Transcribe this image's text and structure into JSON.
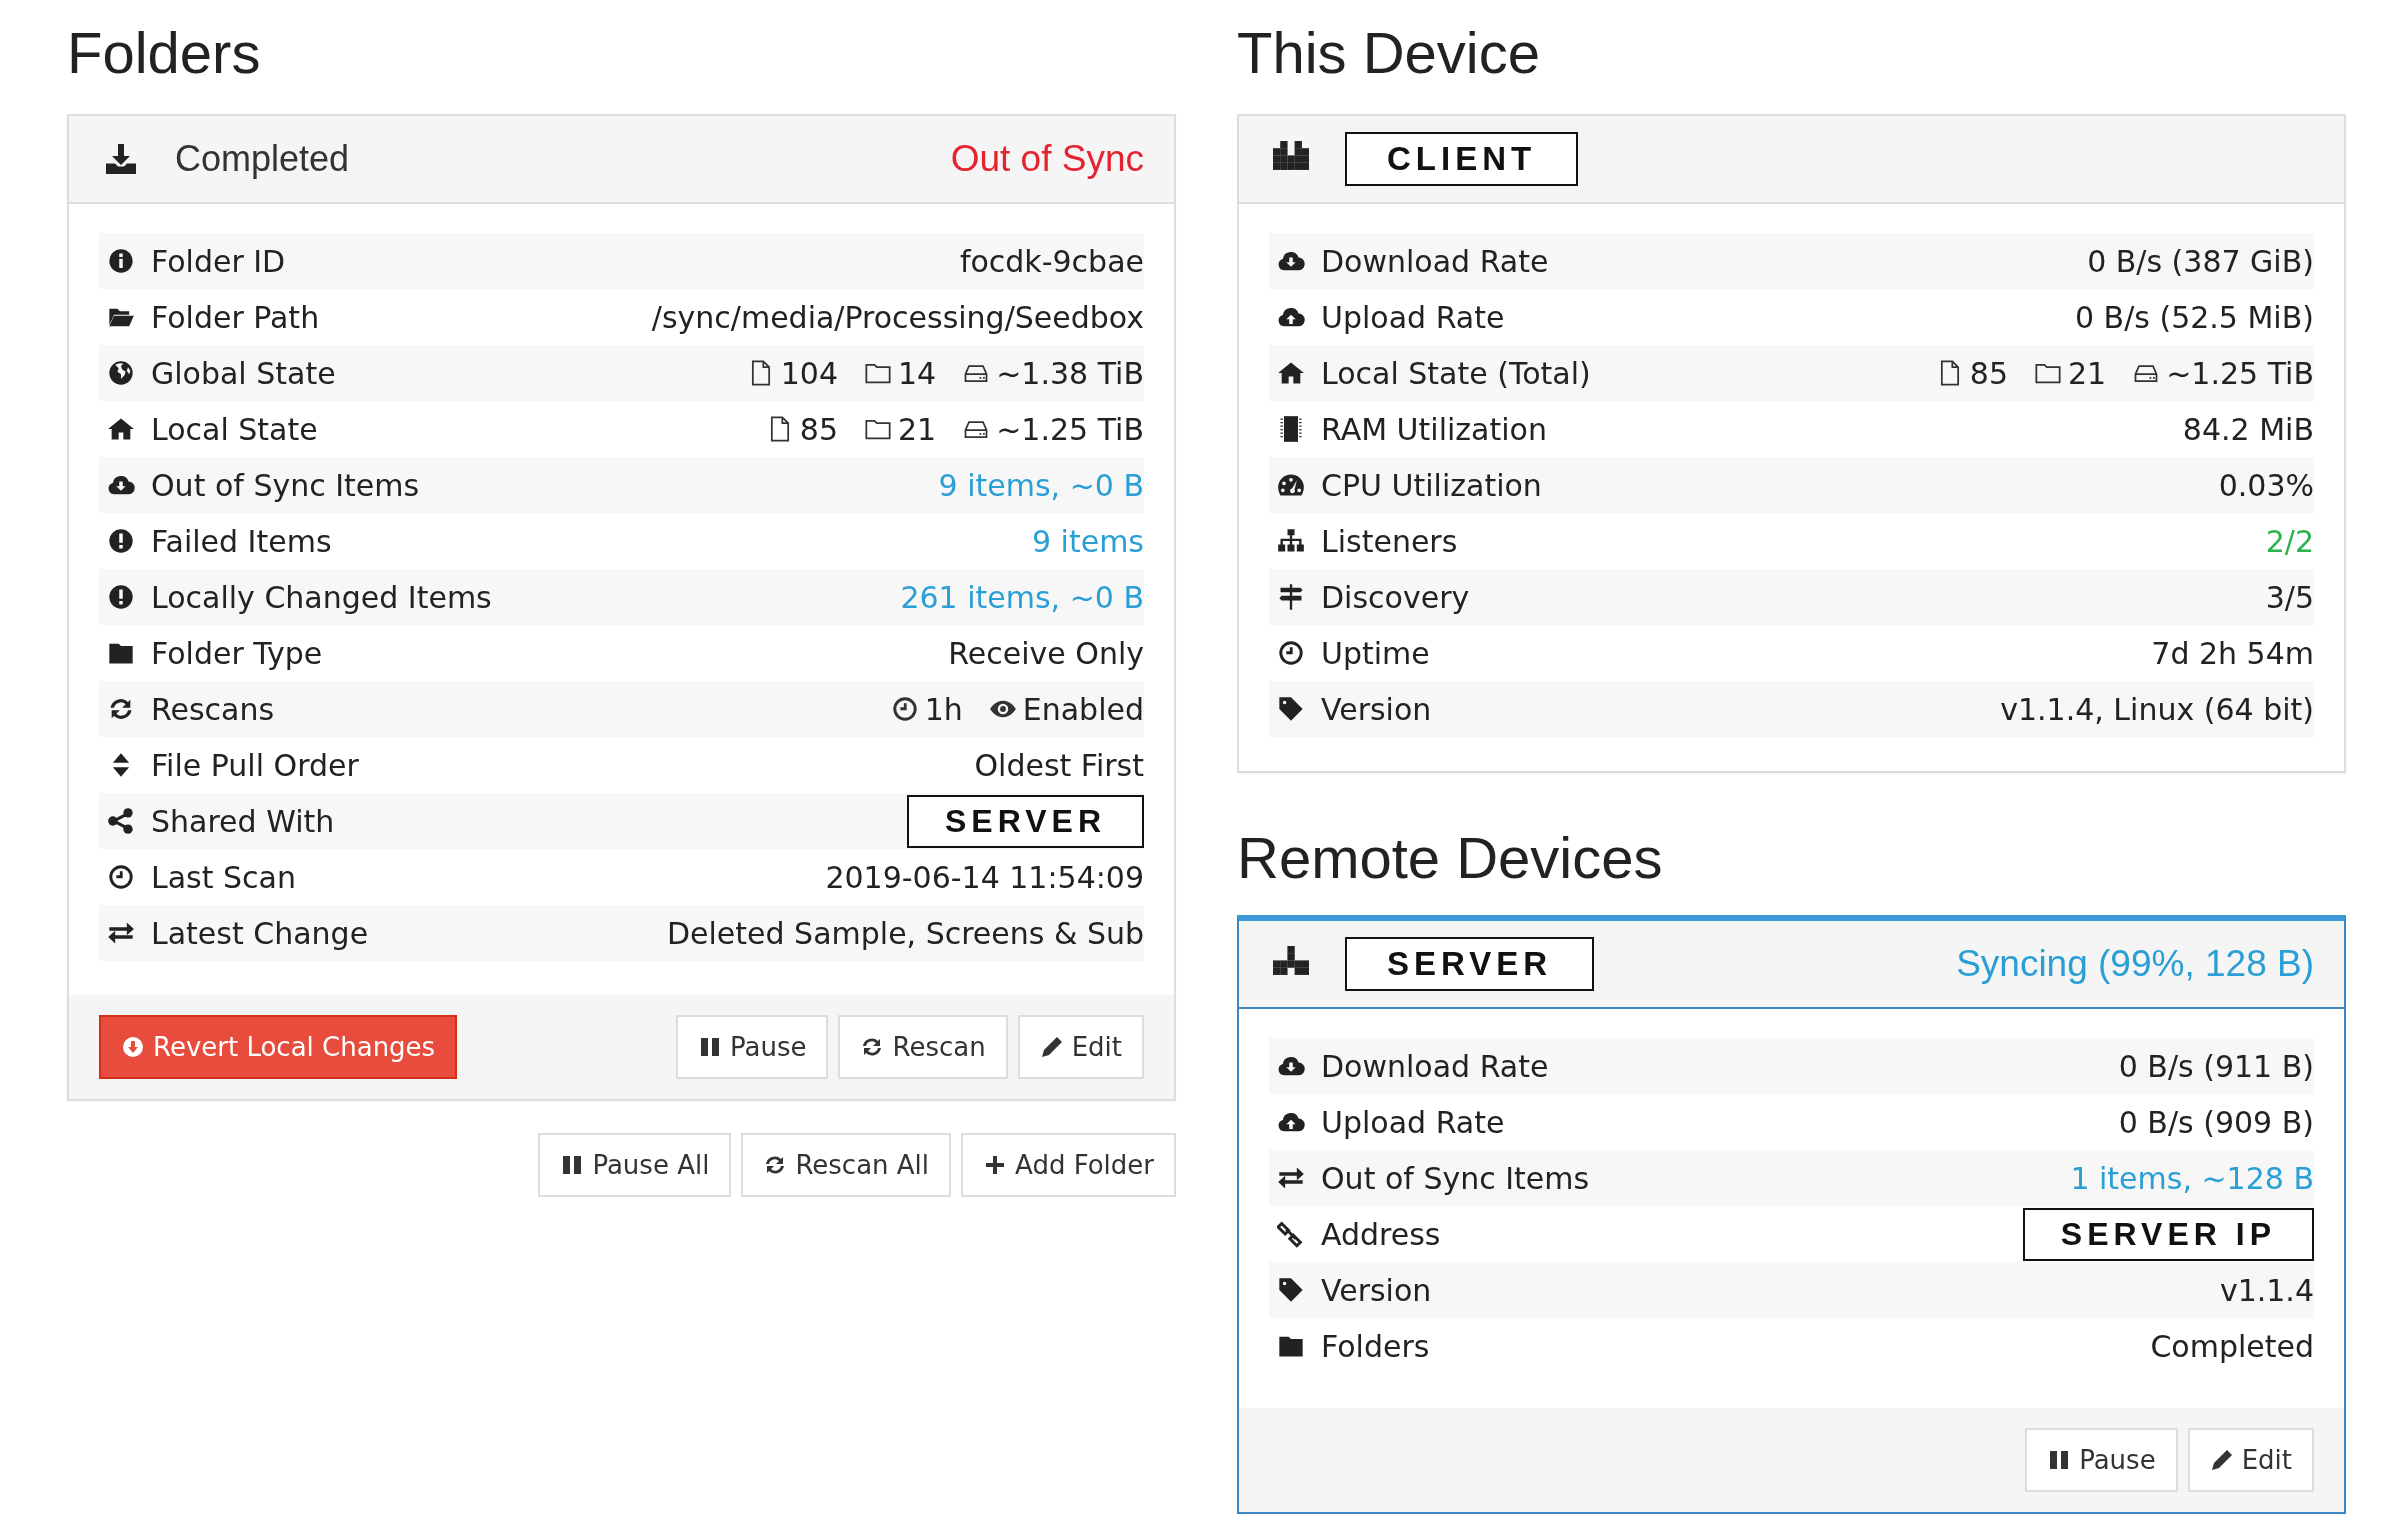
{
  "folders": {
    "heading": "Folders",
    "panel": {
      "name": "Completed",
      "status": {
        "text": "Out of Sync",
        "kind": "danger"
      },
      "rows": [
        {
          "label": "Folder ID",
          "kind": "text",
          "value": "focdk-9cbae"
        },
        {
          "label": "Folder Path",
          "kind": "text",
          "value": "/sync/media/Processing/Seedbox"
        },
        {
          "label": "Global State",
          "kind": "counts",
          "values": [
            "104",
            "14",
            "~1.38 TiB"
          ]
        },
        {
          "label": "Local State",
          "kind": "counts",
          "values": [
            "85",
            "21",
            "~1.25 TiB"
          ]
        },
        {
          "label": "Out of Sync Items",
          "kind": "link",
          "value": "9 items, ~0 B"
        },
        {
          "label": "Failed Items",
          "kind": "link",
          "value": "9 items"
        },
        {
          "label": "Locally Changed Items",
          "kind": "link",
          "value": "261 items, ~0 B"
        },
        {
          "label": "Folder Type",
          "kind": "text",
          "value": "Receive Only"
        },
        {
          "label": "Rescans",
          "kind": "interval",
          "values": [
            "1h",
            "Enabled"
          ]
        },
        {
          "label": "File Pull Order",
          "kind": "text",
          "value": "Oldest First"
        },
        {
          "label": "Shared With",
          "kind": "tag",
          "value": "SERVER"
        },
        {
          "label": "Last Scan",
          "kind": "text",
          "value": "2019-06-14 11:54:09"
        },
        {
          "label": "Latest Change",
          "kind": "text",
          "value": "Deleted Sample, Screens & Sub"
        }
      ],
      "buttons": [
        {
          "label": "Revert Local Changes",
          "kind": "danger"
        },
        {
          "label": "Pause",
          "kind": "default"
        },
        {
          "label": "Rescan",
          "kind": "default"
        },
        {
          "label": "Edit",
          "kind": "default"
        }
      ]
    },
    "actions": [
      {
        "label": "Pause All",
        "kind": "default"
      },
      {
        "label": "Rescan All",
        "kind": "default"
      },
      {
        "label": "Add Folder",
        "kind": "default"
      }
    ]
  },
  "this_device": {
    "heading": "This Device",
    "panel": {
      "name": "CLIENT",
      "rows": [
        {
          "label": "Download Rate",
          "kind": "text",
          "value": "0 B/s (387 GiB)"
        },
        {
          "label": "Upload Rate",
          "kind": "text",
          "value": "0 B/s (52.5 MiB)"
        },
        {
          "label": "Local State (Total)",
          "kind": "counts",
          "values": [
            "85",
            "21",
            "~1.25 TiB"
          ]
        },
        {
          "label": "RAM Utilization",
          "kind": "text",
          "value": "84.2 MiB"
        },
        {
          "label": "CPU Utilization",
          "kind": "text",
          "value": "0.03%"
        },
        {
          "label": "Listeners",
          "kind": "success",
          "value": "2/2"
        },
        {
          "label": "Discovery",
          "kind": "text",
          "value": "3/5"
        },
        {
          "label": "Uptime",
          "kind": "text",
          "value": "7d 2h 54m"
        },
        {
          "label": "Version",
          "kind": "text",
          "value": "v1.1.4, Linux (64 bit)"
        }
      ]
    }
  },
  "remote_devices": {
    "heading": "Remote Devices",
    "panel": {
      "name": "SERVER",
      "status": {
        "text": "Syncing (99%, 128 B)",
        "kind": "info"
      },
      "rows": [
        {
          "label": "Download Rate",
          "kind": "text",
          "value": "0 B/s (911 B)"
        },
        {
          "label": "Upload Rate",
          "kind": "text",
          "value": "0 B/s (909 B)"
        },
        {
          "label": "Out of Sync Items",
          "kind": "link",
          "value": "1 items, ~128 B"
        },
        {
          "label": "Address",
          "kind": "tag",
          "value": "SERVER IP"
        },
        {
          "label": "Version",
          "kind": "text",
          "value": "v1.1.4"
        },
        {
          "label": "Folders",
          "kind": "text",
          "value": "Completed"
        }
      ],
      "buttons": [
        {
          "label": "Pause",
          "kind": "default"
        },
        {
          "label": "Edit",
          "kind": "default"
        }
      ]
    }
  }
}
